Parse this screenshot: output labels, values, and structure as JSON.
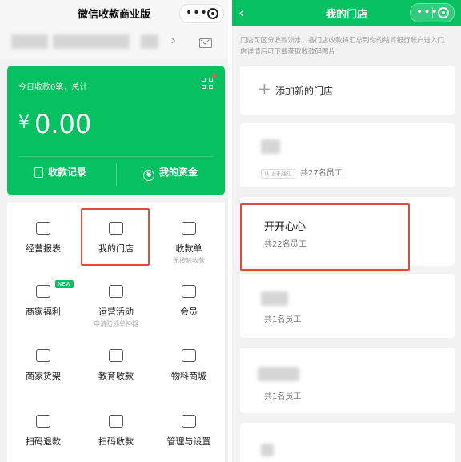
{
  "left": {
    "title": "微信收款商业版",
    "merchant": {
      "name": "",
      "chevron": "›"
    },
    "capsule": {
      "dots": "•••"
    },
    "card": {
      "summary": "今日收款0笔，总计",
      "currency": "¥",
      "amount": "0.00",
      "records_label": "收款记录",
      "funds_label": "我的资金",
      "funds_icon": "¥"
    },
    "grid": [
      {
        "label": "经营报表",
        "icon": "bar-chart-icon",
        "sub": ""
      },
      {
        "label": "我的门店",
        "icon": "store-icon",
        "sub": ""
      },
      {
        "label": "收款单",
        "icon": "receipt-icon",
        "sub": "无接触收款"
      },
      {
        "label": "商家福利",
        "icon": "gift-icon",
        "sub": "",
        "badge": "NEW"
      },
      {
        "label": "运营活动",
        "icon": "flag-icon",
        "sub": "申请防逃单神器"
      },
      {
        "label": "会员",
        "icon": "member-icon",
        "sub": ""
      },
      {
        "label": "商家货架",
        "icon": "shelf-icon",
        "sub": ""
      },
      {
        "label": "教育收款",
        "icon": "education-icon",
        "sub": ""
      },
      {
        "label": "物料商城",
        "icon": "cart-icon",
        "sub": ""
      },
      {
        "label": "扫码退款",
        "icon": "scan-refund-icon",
        "sub": ""
      },
      {
        "label": "扫码收款",
        "icon": "scan-icon",
        "sub": ""
      },
      {
        "label": "管理与设置",
        "icon": "gear-icon",
        "sub": ""
      }
    ]
  },
  "right": {
    "title": "我的门店",
    "back": "‹",
    "description": "门店可区分收款流水，各门店收款将汇总到你的结算银行账户进入门店详情后可下载获取收款码图片",
    "add_store": {
      "plus": "+",
      "label": "添加新的门店"
    },
    "stores": [
      {
        "name": "",
        "tag": "认证未通过",
        "count": "共27名员工"
      },
      {
        "name": "开开心心",
        "tag": "",
        "count": "共22名员工"
      },
      {
        "name": "",
        "tag": "",
        "count": "共1名员工"
      },
      {
        "name": "",
        "tag": "",
        "count": "共1名员工"
      },
      {
        "name": "",
        "tag": "",
        "count": ""
      }
    ]
  },
  "colors": {
    "accent": "#07c160",
    "highlight": "#e34a3b",
    "badge_red": "#fa5151"
  }
}
